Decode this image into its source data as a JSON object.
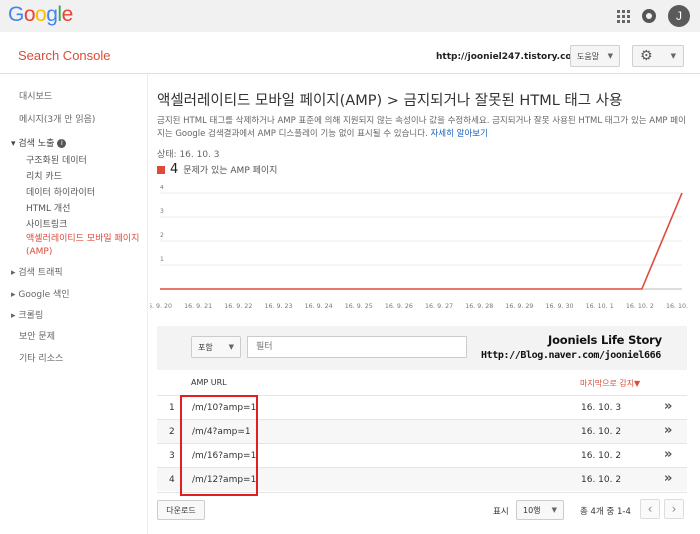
{
  "google": {
    "logo_letters": [
      {
        "ch": "G",
        "color": "#4285f4"
      },
      {
        "ch": "o",
        "color": "#ea4335"
      },
      {
        "ch": "o",
        "color": "#fbbc05"
      },
      {
        "ch": "g",
        "color": "#4285f4"
      },
      {
        "ch": "l",
        "color": "#34a853"
      },
      {
        "ch": "e",
        "color": "#ea4335"
      }
    ],
    "avatar_letter": "J"
  },
  "header": {
    "product_title": "Search Console",
    "site_url": "http://jooniel247.tistory.com/",
    "help_label": "도움말",
    "settings_icon": "gear-icon"
  },
  "sidebar": {
    "dashboard": "대시보드",
    "messages": "메시지(3개 안 읽음)",
    "search_appearance": "▾ 검색 노출",
    "info_badge": "i",
    "sub_items": [
      "구조화된 데이터",
      "리치 카드",
      "데이터 하이라이터",
      "HTML 개선",
      "사이트링크"
    ],
    "active_item": "액셀러레이티드 모바일 페이지(AMP)",
    "search_traffic": "▸ 검색 트래픽",
    "google_index": "▸ Google 색인",
    "crawl": "▸ 크롤링",
    "security_issues": "보안 문제",
    "other_resources": "기타 리소스"
  },
  "main": {
    "title": "액셀러레이티드 모바일 페이지(AMP) > 금지되거나 잘못된 HTML 태그 사용",
    "description": "금지된 HTML 태그를 삭제하거나 AMP 표준에 의해 지원되지 않는 속성이나 값을 수정하세요. 금지되거나 잘못 사용된 HTML 태그가 있는 AMP 페이지는 Google 검색결과에서 AMP 디스플레이 기능 없이 표시될 수 있습니다.",
    "learn_more": "자세히 알아보기",
    "status": "상태: 16. 10. 3",
    "legend_count": "4",
    "legend_label": "문제가 있는 AMP 페이지",
    "accent_color": "#dd4b39"
  },
  "chart_data": {
    "type": "line",
    "x": [
      "16. 9. 20",
      "16. 9. 21",
      "16. 9. 22",
      "16. 9. 23",
      "16. 9. 24",
      "16. 9. 25",
      "16. 9. 26",
      "16. 9. 27",
      "16. 9. 28",
      "16. 9. 29",
      "16. 9. 30",
      "16. 10. 1",
      "16. 10. 2",
      "16. 10. 3"
    ],
    "series": [
      {
        "values": [
          0,
          0,
          0,
          0,
          0,
          0,
          0,
          0,
          0,
          0,
          0,
          0,
          0,
          4
        ],
        "color": "#dd4b39"
      }
    ],
    "ylim": [
      0,
      4
    ],
    "yticks": [
      "1",
      "2",
      "3",
      "4"
    ],
    "grid": true
  },
  "filter": {
    "mode_label": "포함",
    "placeholder": "필터"
  },
  "watermark": {
    "line1": "Jooniels Life Story",
    "line2": "Http://Blog.naver.com/jooniel666"
  },
  "table": {
    "col_url": "AMP URL",
    "col_date": "마지막으로 감지▼",
    "rows": [
      {
        "idx": "1",
        "url": "/m/10?amp=1",
        "date": "16. 10. 3"
      },
      {
        "idx": "2",
        "url": "/m/4?amp=1",
        "date": "16. 10. 2"
      },
      {
        "idx": "3",
        "url": "/m/16?amp=1",
        "date": "16. 10. 2"
      },
      {
        "idx": "4",
        "url": "/m/12?amp=1",
        "date": "16. 10. 2"
      }
    ],
    "row_action": "»"
  },
  "footer": {
    "download_label": "다운로드",
    "show_label": "표시",
    "rows_per_page": "10행",
    "pager_text": "총 4개 중 1-4",
    "prev": "‹",
    "next": "›"
  }
}
